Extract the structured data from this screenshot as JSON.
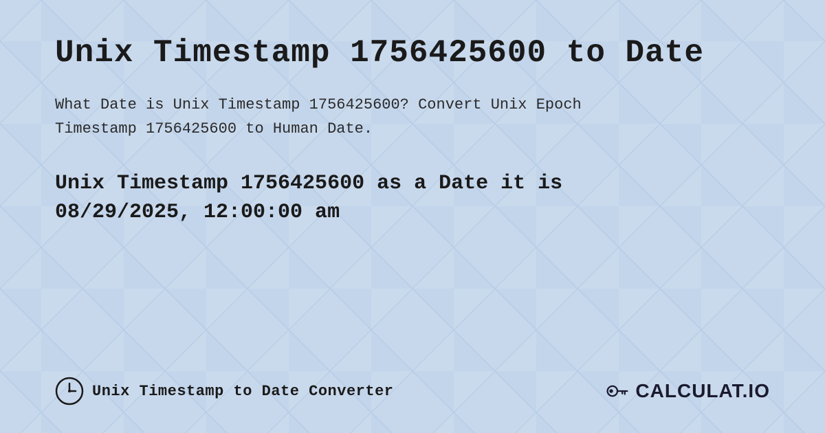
{
  "page": {
    "title": "Unix Timestamp 1756425600 to Date",
    "description_line1": "What Date is Unix Timestamp 1756425600? Convert Unix Epoch",
    "description_line2": "Timestamp 1756425600 to Human Date.",
    "result_line1": "Unix Timestamp 1756425600 as a Date it is",
    "result_line2": "08/29/2025, 12:00:00 am",
    "footer_label": "Unix Timestamp to Date Converter",
    "logo_text": "CALCULAT.IO"
  },
  "colors": {
    "background": "#c8d8ec",
    "title_color": "#1a1a1a",
    "text_color": "#2a2a2a",
    "accent": "#1a5276"
  }
}
